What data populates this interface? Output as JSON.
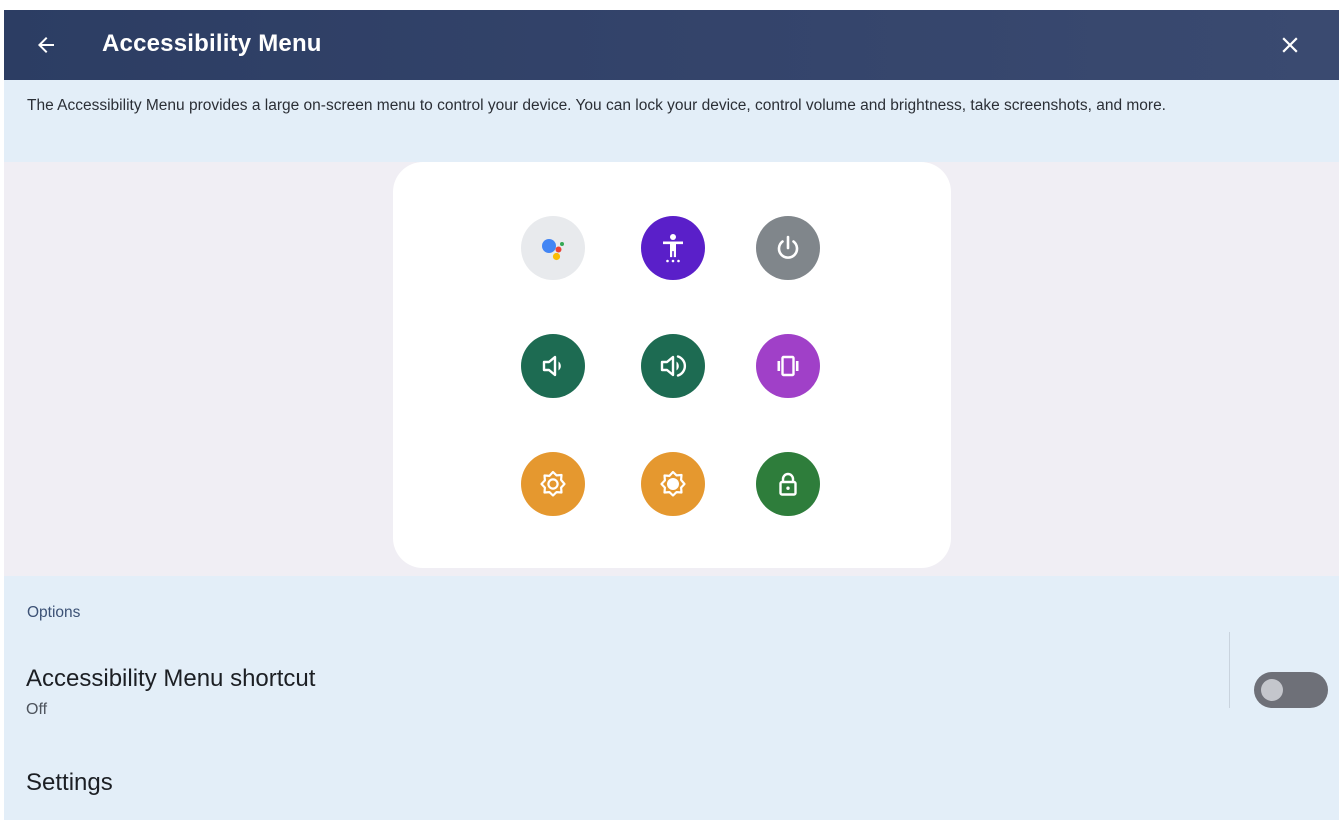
{
  "header": {
    "title": "Accessibility Menu",
    "back_icon": "arrow-back-icon",
    "close_icon": "close-icon"
  },
  "description": "The Accessibility Menu provides a large on-screen menu to control your device. You can lock your device, control volume and brightness, take screenshots, and more.",
  "preview": {
    "tiles": [
      {
        "icon": "google-assistant-icon",
        "color": "#e8eaed"
      },
      {
        "icon": "accessibility-settings-icon",
        "color": "#5a1fc9"
      },
      {
        "icon": "power-icon",
        "color": "#80868b"
      },
      {
        "icon": "volume-down-icon",
        "color": "#1d6b52"
      },
      {
        "icon": "volume-up-icon",
        "color": "#1d6b52"
      },
      {
        "icon": "vibrate-icon",
        "color": "#a040c8"
      },
      {
        "icon": "brightness-down-icon",
        "color": "#e5982f"
      },
      {
        "icon": "brightness-up-icon",
        "color": "#e5982f"
      },
      {
        "icon": "lock-icon",
        "color": "#2e7d3b"
      }
    ]
  },
  "options": {
    "header": "Options",
    "shortcut": {
      "title": "Accessibility Menu shortcut",
      "status": "Off",
      "enabled": false
    },
    "settings": {
      "title": "Settings"
    }
  },
  "colors": {
    "topbar": "#2c3d63",
    "background": "#e3eef8",
    "preview_background": "#f0eef4",
    "accent": "#3c5175"
  }
}
